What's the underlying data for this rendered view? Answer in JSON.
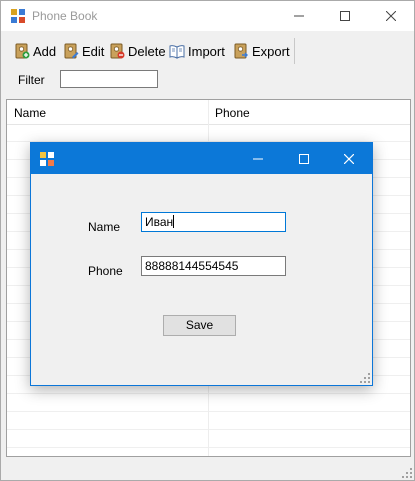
{
  "window": {
    "title": "Phone Book"
  },
  "toolbar": {
    "items": [
      {
        "label": "Add",
        "icon": "add-icon"
      },
      {
        "label": "Edit",
        "icon": "edit-icon"
      },
      {
        "label": "Delete",
        "icon": "delete-icon"
      },
      {
        "label": "Import",
        "icon": "import-icon"
      },
      {
        "label": "Export",
        "icon": "export-icon"
      }
    ]
  },
  "filter": {
    "label": "Filter",
    "value": ""
  },
  "grid": {
    "columns": [
      "Name",
      "Phone"
    ],
    "rows": []
  },
  "dialog": {
    "title": "",
    "name_label": "Name",
    "name_value": "Иван",
    "phone_label": "Phone",
    "phone_value": "88888144554545",
    "save_label": "Save"
  },
  "colors": {
    "dialog_accent": "#0c78d8",
    "focus_border": "#0078d7"
  }
}
